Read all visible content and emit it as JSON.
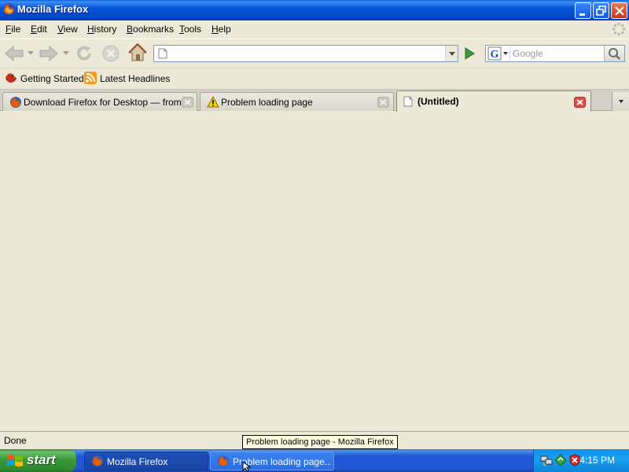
{
  "window": {
    "title": "Mozilla Firefox"
  },
  "menu": {
    "items": [
      {
        "first": "F",
        "rest": "ile"
      },
      {
        "first": "E",
        "rest": "dit"
      },
      {
        "first": "V",
        "rest": "iew"
      },
      {
        "first": "H",
        "rest": "istory"
      },
      {
        "first": "B",
        "rest": "ookmarks"
      },
      {
        "first": "T",
        "rest": "ools"
      },
      {
        "first": "H",
        "rest": "elp"
      }
    ]
  },
  "nav": {
    "url_value": "",
    "search_placeholder": "Google"
  },
  "bookmarks": {
    "items": [
      "Getting Started",
      "Latest Headlines"
    ]
  },
  "tabs": [
    {
      "label": "Download Firefox for Desktop — from ...",
      "icon": "firefox-icon",
      "active": false
    },
    {
      "label": "Problem loading page",
      "icon": "warning-icon",
      "active": false
    },
    {
      "label": "(Untitled)",
      "icon": "page-icon",
      "active": true
    }
  ],
  "status": {
    "text": "Done"
  },
  "tooltip": {
    "text": "Problem loading page - Mozilla Firefox"
  },
  "taskbar": {
    "start_label": "start",
    "tasks": [
      "Mozilla Firefox",
      "Problem loading page..."
    ],
    "clock": "4:15 PM"
  },
  "colors": {
    "titlebar": "#0054e3",
    "chrome": "#ece9d8",
    "taskbar": "#245edb",
    "start": "#3c9a3c"
  }
}
